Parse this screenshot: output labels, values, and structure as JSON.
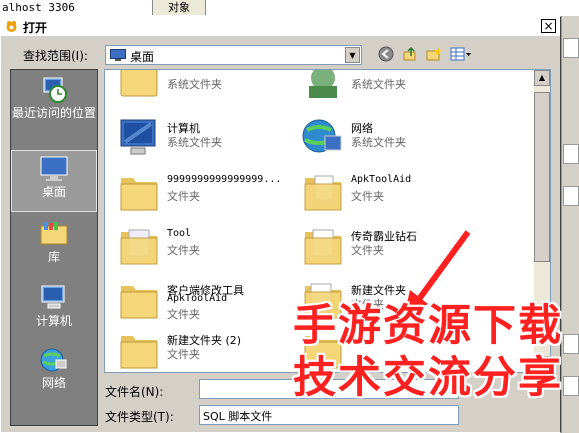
{
  "background": {
    "host_text": "alhost 3306",
    "tab_text": "对象"
  },
  "dialog": {
    "title": "打开",
    "close_label": "×"
  },
  "lookin": {
    "label": "查找范围(I):",
    "value": "桌面"
  },
  "toolbar": {
    "back_icon": "back-arrow-icon",
    "up_icon": "up-folder-icon",
    "new_folder_icon": "new-folder-icon",
    "view_icon": "view-menu-icon"
  },
  "places": [
    {
      "label": "最近访问的位置",
      "icon": "recent-icon"
    },
    {
      "label": "桌面",
      "icon": "desktop-icon"
    },
    {
      "label": "库",
      "icon": "library-icon"
    },
    {
      "label": "计算机",
      "icon": "computer-icon"
    },
    {
      "label": "网络",
      "icon": "network-icon"
    }
  ],
  "files": [
    {
      "name": "",
      "type": "系统文件夹",
      "icon": "library-folder-icon"
    },
    {
      "name": "",
      "type": "系统文件夹",
      "icon": "user-folder-icon"
    },
    {
      "name": "计算机",
      "type": "系统文件夹",
      "icon": "computer-icon"
    },
    {
      "name": "网络",
      "type": "系统文件夹",
      "icon": "network-icon"
    },
    {
      "name": "9999999999999999...",
      "type": "文件夹",
      "icon": "folder-icon"
    },
    {
      "name": "ApkToolAid",
      "type": "文件夹",
      "icon": "folder-icon"
    },
    {
      "name": "Tool",
      "type": "文件夹",
      "icon": "folder-icon"
    },
    {
      "name": "传奇霸业钻石",
      "type": "文件夹",
      "icon": "folder-icon"
    },
    {
      "name": "客户端修改工具",
      "name2": "ApkToolAid",
      "type": "文件夹",
      "icon": "folder-icon"
    },
    {
      "name": "新建文件夹",
      "type": "文件夹",
      "icon": "folder-icon"
    },
    {
      "name": "新建文件夹 (2)",
      "type": "文件夹",
      "icon": "folder-icon"
    },
    {
      "name": "",
      "type": "",
      "icon": "folder-icon"
    }
  ],
  "filename": {
    "label": "文件名(N):",
    "value": ""
  },
  "filetype": {
    "label": "文件类型(T):",
    "value": "SQL 脚本文件"
  },
  "watermark": {
    "line1": "手游资源下载",
    "line2": "技术交流分享"
  },
  "colors": {
    "watermark": "#ff2020",
    "folder": "#f5d77a",
    "places_bg": "#808080"
  }
}
